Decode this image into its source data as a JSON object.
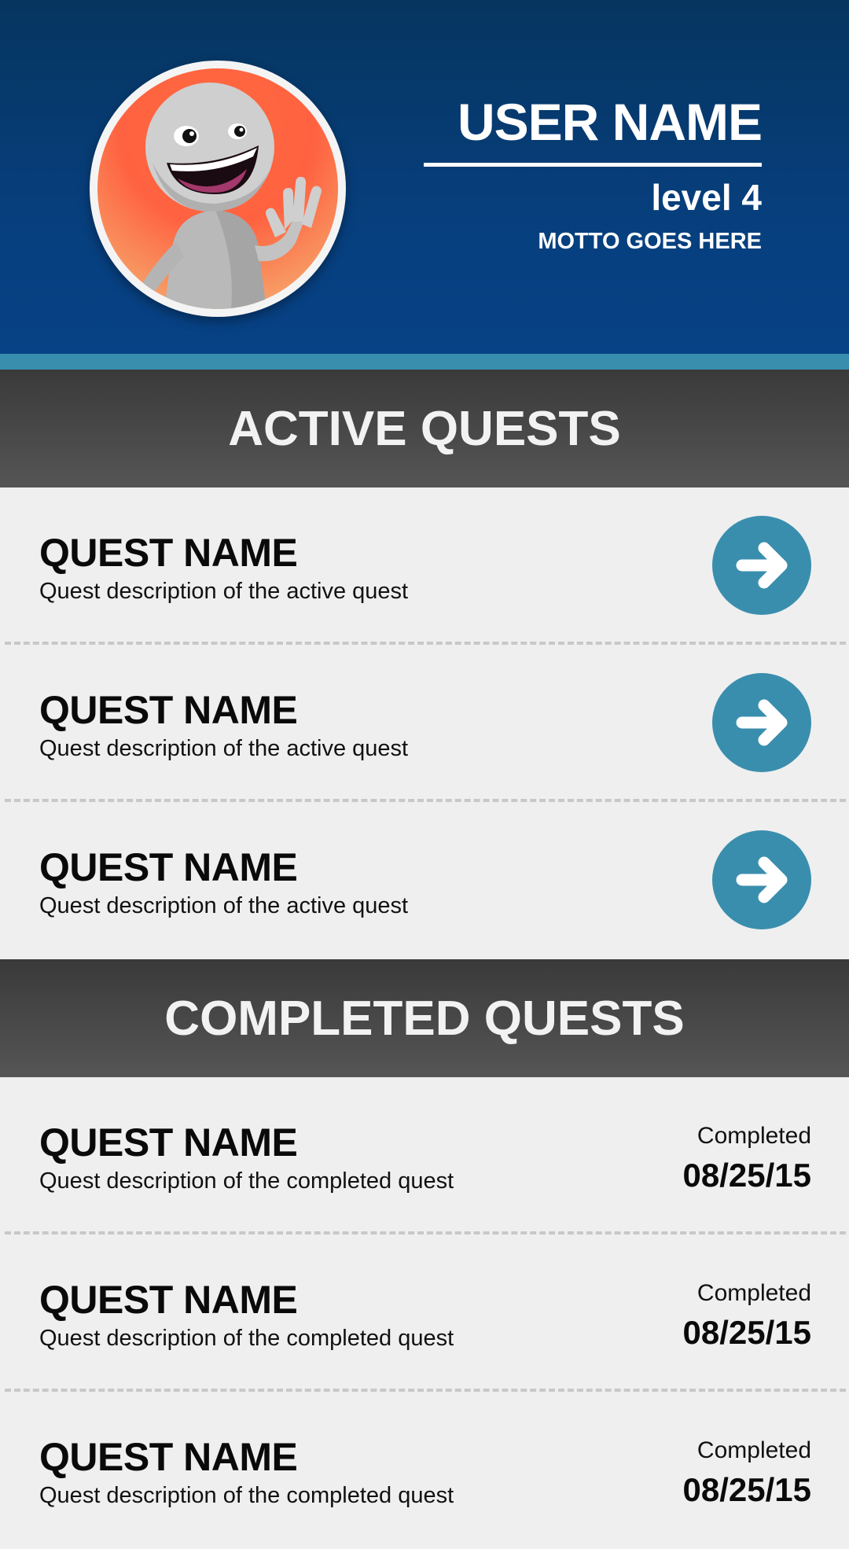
{
  "profile": {
    "user_name": "USER NAME",
    "level": "level 4",
    "motto": "MOTTO GOES HERE",
    "avatar_icon": "waving-character-avatar"
  },
  "colors": {
    "header_top": "#06355f",
    "header_bottom": "#074286",
    "accent": "#3a8ead",
    "section_header": "#444444",
    "avatar_bg": "#ff6240"
  },
  "active_section": {
    "title": "ACTIVE QUESTS",
    "quests": [
      {
        "name": "QUEST NAME",
        "description": "Quest description of the active quest",
        "icon": "arrow-right-icon"
      },
      {
        "name": "QUEST NAME",
        "description": "Quest description of the active quest",
        "icon": "arrow-right-icon"
      },
      {
        "name": "QUEST NAME",
        "description": "Quest description of the active quest",
        "icon": "arrow-right-icon"
      }
    ]
  },
  "completed_section": {
    "title": "COMPLETED QUESTS",
    "quests": [
      {
        "name": "QUEST NAME",
        "description": "Quest description of the completed quest",
        "status_label": "Completed",
        "date": "08/25/15"
      },
      {
        "name": "QUEST NAME",
        "description": "Quest description of the completed quest",
        "status_label": "Completed",
        "date": "08/25/15"
      },
      {
        "name": "QUEST NAME",
        "description": "Quest description of the completed quest",
        "status_label": "Completed",
        "date": "08/25/15"
      }
    ]
  }
}
